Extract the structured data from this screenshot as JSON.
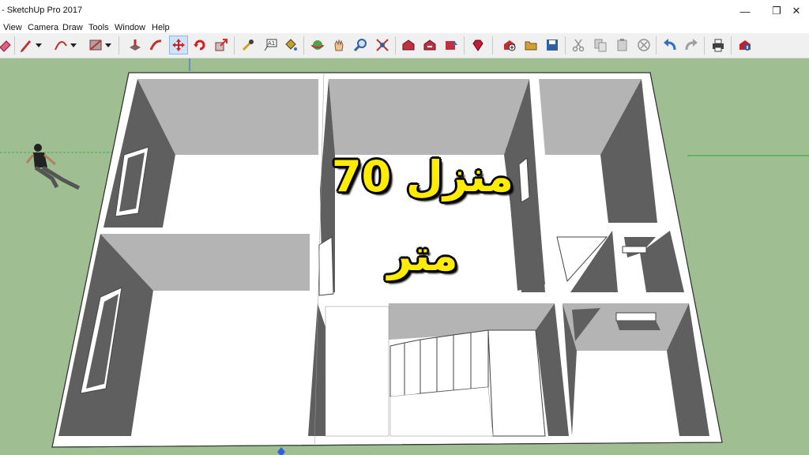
{
  "window": {
    "title": "- SketchUp Pro 2017",
    "minimize_glyph": "—",
    "restore_glyph": "❐",
    "close_glyph": "✕"
  },
  "menu": {
    "items": [
      {
        "label": "View"
      },
      {
        "label": "Camera"
      },
      {
        "label": "Draw"
      },
      {
        "label": "Tools"
      },
      {
        "label": "Window"
      },
      {
        "label": "Help"
      }
    ]
  },
  "toolbar": {
    "tools": [
      {
        "name": "eraser-icon",
        "color": "#e06080"
      },
      {
        "name": "pencil-icon",
        "color": "#c03030"
      },
      {
        "name": "arc-icon",
        "color": "#c03030"
      },
      {
        "name": "rectangle-icon",
        "color": "#a05050"
      },
      {
        "name": "push-pull-icon",
        "color": "#c03030"
      },
      {
        "name": "follow-me-icon",
        "color": "#c03030"
      },
      {
        "name": "move-icon",
        "color": "#d02020"
      },
      {
        "name": "rotate-icon",
        "color": "#d02020"
      },
      {
        "name": "scale-icon",
        "color": "#d03030"
      },
      {
        "name": "tape-measure-icon",
        "color": "#d0a020"
      },
      {
        "name": "text-icon",
        "color": "#404040"
      },
      {
        "name": "paint-bucket-icon",
        "color": "#c0a030"
      },
      {
        "name": "orbit-icon",
        "color": "#c03030"
      },
      {
        "name": "pan-icon",
        "color": "#e0a070"
      },
      {
        "name": "zoom-icon",
        "color": "#3060a0"
      },
      {
        "name": "zoom-extents-icon",
        "color": "#c03030"
      },
      {
        "name": "warehouse-icon",
        "color": "#c03040"
      },
      {
        "name": "share-model-icon",
        "color": "#c03040"
      },
      {
        "name": "extension-warehouse-icon",
        "color": "#c03040"
      },
      {
        "name": "ruby-icon",
        "color": "#c02030"
      },
      {
        "name": "new-icon",
        "color": "#c03030"
      },
      {
        "name": "open-icon",
        "color": "#d0a030"
      },
      {
        "name": "save-icon",
        "color": "#3060a0"
      },
      {
        "name": "cut-icon",
        "color": "#909090"
      },
      {
        "name": "copy-icon",
        "color": "#909090"
      },
      {
        "name": "paste-icon",
        "color": "#909090"
      },
      {
        "name": "delete-icon",
        "color": "#909090"
      },
      {
        "name": "undo-icon",
        "color": "#3070c0"
      },
      {
        "name": "redo-icon",
        "color": "#909090"
      },
      {
        "name": "print-icon",
        "color": "#404040"
      },
      {
        "name": "model-info-icon",
        "color": "#c02030"
      }
    ]
  },
  "overlay": {
    "line1": "منزل 70",
    "line2": "متر",
    "text_color": "#ffec00",
    "outline_color": "#000000"
  },
  "colors": {
    "ground": "#9fbe91",
    "wall_top": "#ffffff",
    "wall_inner": "#5f5f5f",
    "wall_back": "#b4b4b4",
    "floor": "#ffffff",
    "axis_green": "#3cb04a"
  }
}
